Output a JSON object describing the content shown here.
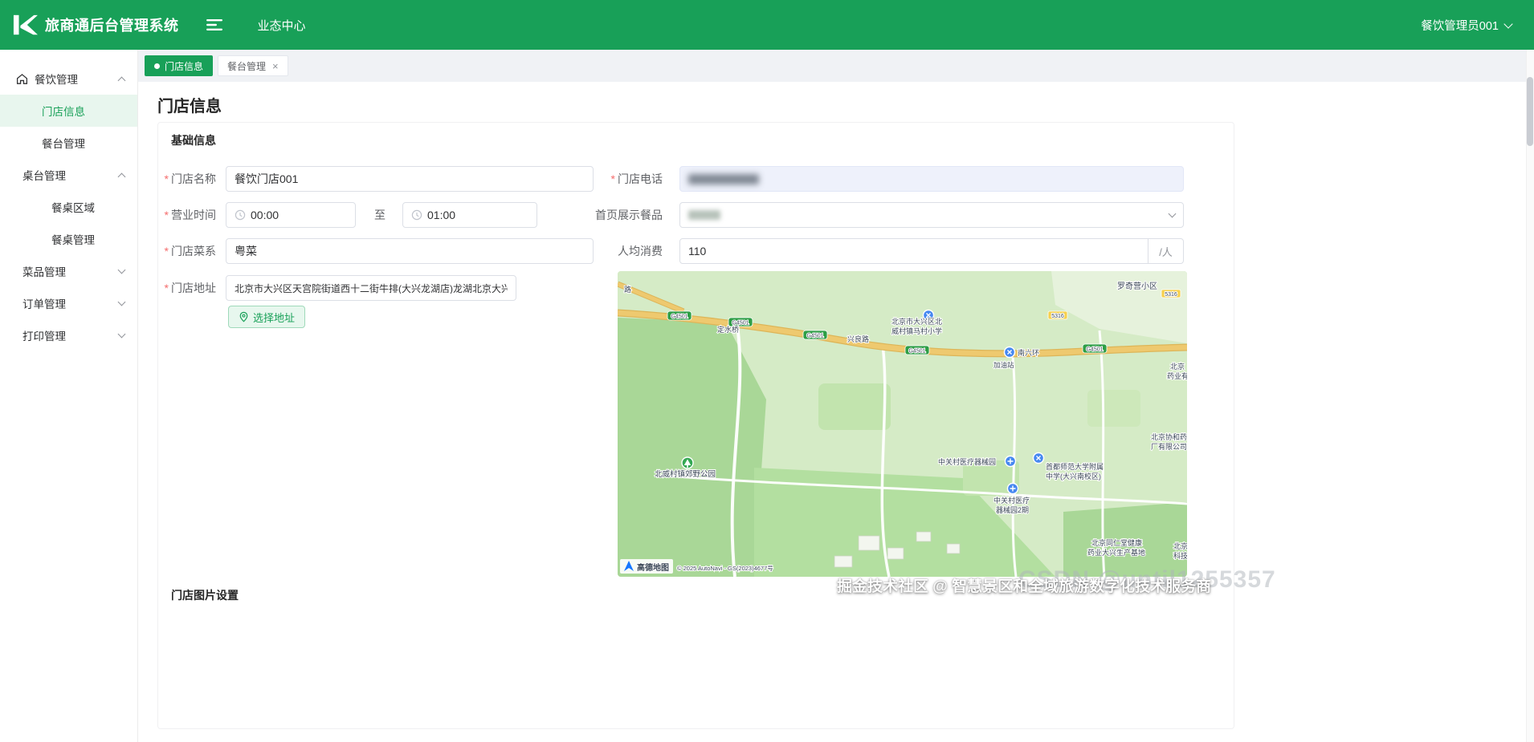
{
  "colors": {
    "primary": "#18a058",
    "sidebar_active_bg": "#e8f6ee",
    "tabbar_bg": "#f0f2f5",
    "phone_field_bg": "#eef1fb",
    "required_mark": "#f56c6c",
    "map_park": "#a9d797",
    "map_road": "#eec96f",
    "highway_badge": "#2e9e46",
    "route_badge": "#f6d04d"
  },
  "header": {
    "app_title": "旅商通后台管理系统",
    "nav_center": "业态中心",
    "user_name": "餐饮管理员001"
  },
  "sidebar": {
    "items": [
      {
        "label": "餐饮管理"
      },
      {
        "label": "门店信息"
      },
      {
        "label": "餐台管理"
      },
      {
        "label": "桌台管理"
      },
      {
        "label": "餐桌区域"
      },
      {
        "label": "餐桌管理"
      },
      {
        "label": "菜品管理"
      },
      {
        "label": "订单管理"
      },
      {
        "label": "打印管理"
      }
    ]
  },
  "tabs": {
    "active_label": "门店信息",
    "second_label": "餐台管理",
    "close_icon": "×"
  },
  "page": {
    "title": "门店信息",
    "basic_section": "基础信息",
    "images_section": "门店图片设置",
    "required_mark": "*"
  },
  "form": {
    "store_name_label": "门店名称",
    "store_name_value": "餐饮门店001",
    "store_phone_label": "门店电话",
    "hours_label": "营业时间",
    "hours_start": "00:00",
    "hours_to": "至",
    "hours_end": "01:00",
    "featured_label": "首页展示餐品",
    "cuisine_label": "门店菜系",
    "cuisine_value": "粤菜",
    "avg_label": "人均消费",
    "avg_value": "110",
    "avg_unit": "/人",
    "address_label": "门店地址",
    "address_value": "北京市大兴区天宫院街道西十二街牛排(大兴龙湖店)龙湖北京大兴天街",
    "choose_address": "选择地址"
  },
  "map": {
    "logo": "高德地图",
    "attribution": "© 2025 AutoNavi - GS(2023)4677号",
    "road_badge": "G4501",
    "route_badge": "5316",
    "labels": [
      "罗奇营小区",
      "定水桥",
      "兴良路",
      "北京市大兴区北",
      "威村镇马村小学",
      "南六环",
      "加油站",
      "中关村医疗器械园",
      "首都师范大学附属",
      "中学(大兴南校区)",
      "中关村医疗",
      "器械园2期",
      "北威村镇郊野公园",
      "北京同仁堂健康",
      "药业大兴生产基地",
      "北京协和药",
      "厂有限公司",
      "路",
      "北京",
      "药业有",
      "北京",
      "科技"
    ]
  },
  "watermarks": {
    "overlay": "掘金技术社区 @ 智慧景区和全域旅游数字化技术服务商",
    "background": "CSDN @until1255357"
  }
}
